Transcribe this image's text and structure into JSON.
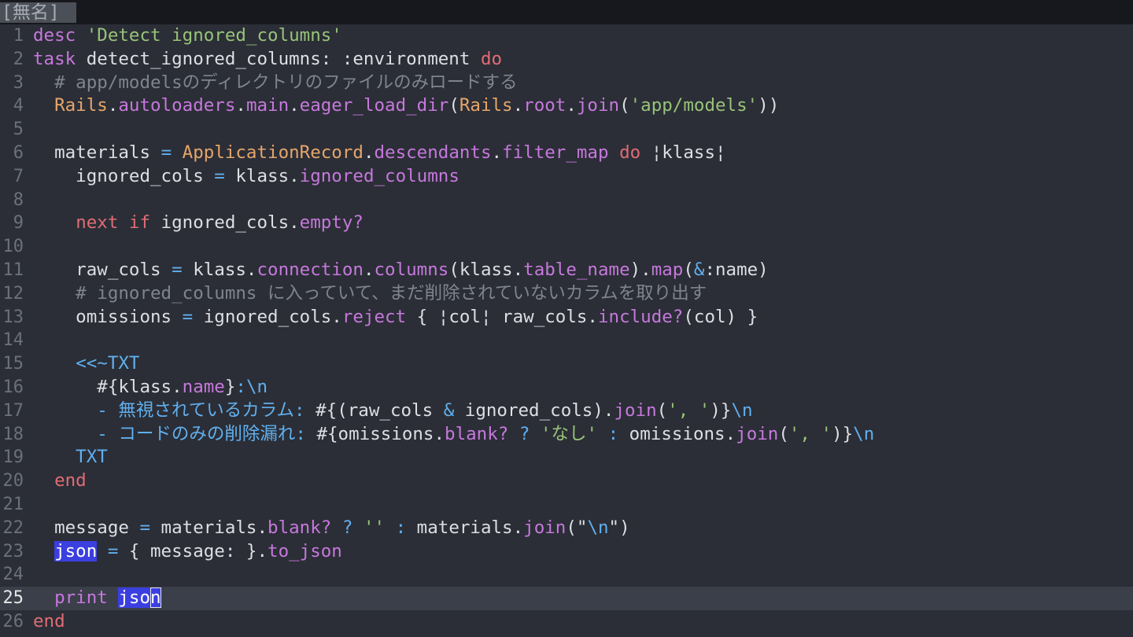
{
  "window": {
    "buffer_name": "[無名]"
  },
  "colors": {
    "background": "#2b2e36",
    "keyword": "#e06c75",
    "method": "#c678dd",
    "string": "#98c379",
    "comment": "#7f848e",
    "constant": "#e5a56b",
    "operator": "#61afef",
    "search_highlight": "#3b3fe0"
  },
  "editor": {
    "cursor_line": 25,
    "lines": [
      {
        "n": "1",
        "tokens": [
          {
            "t": "desc",
            "c": "fn"
          },
          {
            "t": " ",
            "c": "df"
          },
          {
            "t": "'Detect ignored_columns'",
            "c": "st"
          }
        ]
      },
      {
        "n": "2",
        "tokens": [
          {
            "t": "task",
            "c": "fn"
          },
          {
            "t": " detect_ignored_columns: :environment ",
            "c": "df"
          },
          {
            "t": "do",
            "c": "kw"
          }
        ]
      },
      {
        "n": "3",
        "tokens": [
          {
            "t": "  # app/modelsのディレクトリのファイルのみロードする",
            "c": "cm"
          }
        ]
      },
      {
        "n": "4",
        "tokens": [
          {
            "t": "  ",
            "c": "df"
          },
          {
            "t": "Rails",
            "c": "cn"
          },
          {
            "t": ".",
            "c": "df"
          },
          {
            "t": "autoloaders",
            "c": "fn"
          },
          {
            "t": ".",
            "c": "df"
          },
          {
            "t": "main",
            "c": "fn"
          },
          {
            "t": ".",
            "c": "df"
          },
          {
            "t": "eager_load_dir",
            "c": "fn"
          },
          {
            "t": "(",
            "c": "df"
          },
          {
            "t": "Rails",
            "c": "cn"
          },
          {
            "t": ".",
            "c": "df"
          },
          {
            "t": "root",
            "c": "fn"
          },
          {
            "t": ".",
            "c": "df"
          },
          {
            "t": "join",
            "c": "fn"
          },
          {
            "t": "(",
            "c": "df"
          },
          {
            "t": "'app/models'",
            "c": "st"
          },
          {
            "t": "))",
            "c": "df"
          }
        ]
      },
      {
        "n": "5",
        "tokens": []
      },
      {
        "n": "6",
        "tokens": [
          {
            "t": "  materials ",
            "c": "df"
          },
          {
            "t": "=",
            "c": "op"
          },
          {
            "t": " ",
            "c": "df"
          },
          {
            "t": "ApplicationRecord",
            "c": "cn"
          },
          {
            "t": ".",
            "c": "df"
          },
          {
            "t": "descendants",
            "c": "fn"
          },
          {
            "t": ".",
            "c": "df"
          },
          {
            "t": "filter_map",
            "c": "fn"
          },
          {
            "t": " ",
            "c": "df"
          },
          {
            "t": "do",
            "c": "kw"
          },
          {
            "t": " ¦klass¦",
            "c": "df"
          }
        ]
      },
      {
        "n": "7",
        "tokens": [
          {
            "t": "    ignored_cols ",
            "c": "df"
          },
          {
            "t": "=",
            "c": "op"
          },
          {
            "t": " klass.",
            "c": "df"
          },
          {
            "t": "ignored_columns",
            "c": "fn"
          }
        ]
      },
      {
        "n": "8",
        "tokens": []
      },
      {
        "n": "9",
        "tokens": [
          {
            "t": "    ",
            "c": "df"
          },
          {
            "t": "next",
            "c": "kw"
          },
          {
            "t": " ",
            "c": "df"
          },
          {
            "t": "if",
            "c": "kw"
          },
          {
            "t": " ignored_cols.",
            "c": "df"
          },
          {
            "t": "empty?",
            "c": "fn"
          }
        ]
      },
      {
        "n": "10",
        "tokens": []
      },
      {
        "n": "11",
        "tokens": [
          {
            "t": "    raw_cols ",
            "c": "df"
          },
          {
            "t": "=",
            "c": "op"
          },
          {
            "t": " klass.",
            "c": "df"
          },
          {
            "t": "connection",
            "c": "fn"
          },
          {
            "t": ".",
            "c": "df"
          },
          {
            "t": "columns",
            "c": "fn"
          },
          {
            "t": "(klass.",
            "c": "df"
          },
          {
            "t": "table_name",
            "c": "fn"
          },
          {
            "t": ").",
            "c": "df"
          },
          {
            "t": "map",
            "c": "fn"
          },
          {
            "t": "(",
            "c": "df"
          },
          {
            "t": "&",
            "c": "op"
          },
          {
            "t": ":name)",
            "c": "df"
          }
        ]
      },
      {
        "n": "12",
        "tokens": [
          {
            "t": "    # ignored_columns に入っていて、まだ削除されていないカラムを取り出す",
            "c": "cm"
          }
        ]
      },
      {
        "n": "13",
        "tokens": [
          {
            "t": "    omissions ",
            "c": "df"
          },
          {
            "t": "=",
            "c": "op"
          },
          {
            "t": " ignored_cols.",
            "c": "df"
          },
          {
            "t": "reject",
            "c": "fn"
          },
          {
            "t": " { ¦col¦ raw_cols.",
            "c": "df"
          },
          {
            "t": "include?",
            "c": "fn"
          },
          {
            "t": "(col) }",
            "c": "df"
          }
        ]
      },
      {
        "n": "14",
        "tokens": []
      },
      {
        "n": "15",
        "tokens": [
          {
            "t": "    ",
            "c": "df"
          },
          {
            "t": "<<~TXT",
            "c": "op"
          }
        ]
      },
      {
        "n": "16",
        "tokens": [
          {
            "t": "      #{klass.",
            "c": "df"
          },
          {
            "t": "name",
            "c": "fn"
          },
          {
            "t": "}",
            "c": "df"
          },
          {
            "t": ":",
            "c": "op"
          },
          {
            "t": "\\n",
            "c": "op"
          }
        ]
      },
      {
        "n": "17",
        "tokens": [
          {
            "t": "      - 無視されているカラム: ",
            "c": "op"
          },
          {
            "t": "#{(raw_cols ",
            "c": "df"
          },
          {
            "t": "&",
            "c": "op"
          },
          {
            "t": " ignored_cols).",
            "c": "df"
          },
          {
            "t": "join",
            "c": "fn"
          },
          {
            "t": "(",
            "c": "df"
          },
          {
            "t": "', '",
            "c": "st"
          },
          {
            "t": ")}",
            "c": "df"
          },
          {
            "t": "\\n",
            "c": "op"
          }
        ]
      },
      {
        "n": "18",
        "tokens": [
          {
            "t": "      - コードのみの削除漏れ: ",
            "c": "op"
          },
          {
            "t": "#{omissions.",
            "c": "df"
          },
          {
            "t": "blank?",
            "c": "fn"
          },
          {
            "t": " ",
            "c": "df"
          },
          {
            "t": "?",
            "c": "op"
          },
          {
            "t": " ",
            "c": "df"
          },
          {
            "t": "'なし'",
            "c": "st"
          },
          {
            "t": " ",
            "c": "df"
          },
          {
            "t": ":",
            "c": "op"
          },
          {
            "t": " omissions.",
            "c": "df"
          },
          {
            "t": "join",
            "c": "fn"
          },
          {
            "t": "(",
            "c": "df"
          },
          {
            "t": "', '",
            "c": "st"
          },
          {
            "t": ")}",
            "c": "df"
          },
          {
            "t": "\\n",
            "c": "op"
          }
        ]
      },
      {
        "n": "19",
        "tokens": [
          {
            "t": "    TXT",
            "c": "op"
          }
        ]
      },
      {
        "n": "20",
        "tokens": [
          {
            "t": "  ",
            "c": "df"
          },
          {
            "t": "end",
            "c": "kw"
          }
        ]
      },
      {
        "n": "21",
        "tokens": []
      },
      {
        "n": "22",
        "tokens": [
          {
            "t": "  message ",
            "c": "df"
          },
          {
            "t": "=",
            "c": "op"
          },
          {
            "t": " materials.",
            "c": "df"
          },
          {
            "t": "blank?",
            "c": "fn"
          },
          {
            "t": " ",
            "c": "df"
          },
          {
            "t": "?",
            "c": "op"
          },
          {
            "t": " ",
            "c": "df"
          },
          {
            "t": "''",
            "c": "st"
          },
          {
            "t": " ",
            "c": "df"
          },
          {
            "t": ":",
            "c": "op"
          },
          {
            "t": " materials.",
            "c": "df"
          },
          {
            "t": "join",
            "c": "fn"
          },
          {
            "t": "(\"",
            "c": "df"
          },
          {
            "t": "\\n",
            "c": "op"
          },
          {
            "t": "\")",
            "c": "df"
          }
        ]
      },
      {
        "n": "23",
        "tokens": [
          {
            "t": "  ",
            "c": "df"
          },
          {
            "t": "json",
            "c": "hl"
          },
          {
            "t": " ",
            "c": "df"
          },
          {
            "t": "=",
            "c": "op"
          },
          {
            "t": " { message: }.",
            "c": "df"
          },
          {
            "t": "to_json",
            "c": "fn"
          }
        ]
      },
      {
        "n": "24",
        "tokens": []
      },
      {
        "n": "25",
        "tokens": [
          {
            "t": "  ",
            "c": "df"
          },
          {
            "t": "print",
            "c": "fn"
          },
          {
            "t": " ",
            "c": "df"
          },
          {
            "t": "jso",
            "c": "hl"
          },
          {
            "t": "n",
            "c": "cur"
          }
        ]
      },
      {
        "n": "26",
        "tokens": [
          {
            "t": "end",
            "c": "kw"
          }
        ]
      }
    ]
  }
}
